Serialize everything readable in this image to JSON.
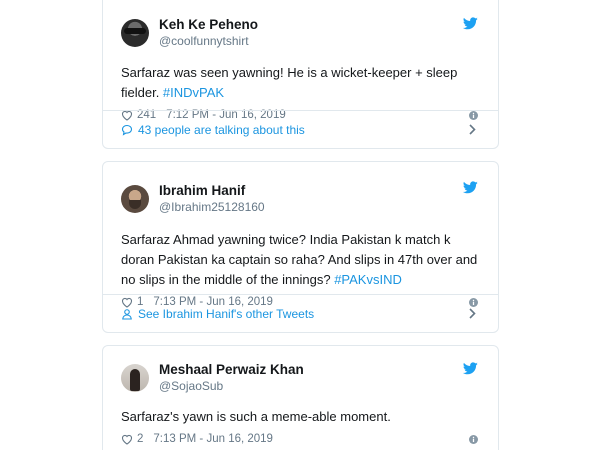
{
  "tweets": [
    {
      "display_name": "Keh Ke Peheno",
      "handle": "@coolfunnytshirt",
      "text_before": "Sarfaraz was seen yawning! He is a wicket-keeper + sleep fielder. ",
      "hashtag": "#INDvPAK",
      "text_after": "",
      "likes": "241",
      "timestamp": "7:12 PM - Jun 16, 2019",
      "footer_label": "43 people are talking about this",
      "footer_icon": "comment-bubble-icon"
    },
    {
      "display_name": "Ibrahim Hanif",
      "handle": "@Ibrahim25128160",
      "text_before": "Sarfaraz Ahmad yawning twice? India Pakistan k match k doran Pakistan ka captain so raha? And slips in 47th over and no slips in the middle of the innings? ",
      "hashtag": "#PAKvsIND",
      "text_after": "",
      "likes": "1",
      "timestamp": "7:13 PM - Jun 16, 2019",
      "footer_label": "See Ibrahim Hanif's other Tweets",
      "footer_icon": "person-icon"
    },
    {
      "display_name": "Meshaal Perwaiz Khan",
      "handle": "@SojaoSub",
      "text_before": "Sarfaraz's yawn is such a meme-able moment.",
      "hashtag": "",
      "text_after": "",
      "likes": "2",
      "timestamp": "7:13 PM - Jun 16, 2019",
      "footer_label": "",
      "footer_icon": ""
    }
  ],
  "colors": {
    "twitter_blue": "#1da1f2",
    "link_blue": "#1b95e0",
    "secondary_text": "#657786",
    "border": "#e1e8ed"
  },
  "icons": {
    "brand": "twitter-bird-icon",
    "like": "heart-icon",
    "info": "info-icon",
    "chevron": "chevron-right-icon"
  }
}
